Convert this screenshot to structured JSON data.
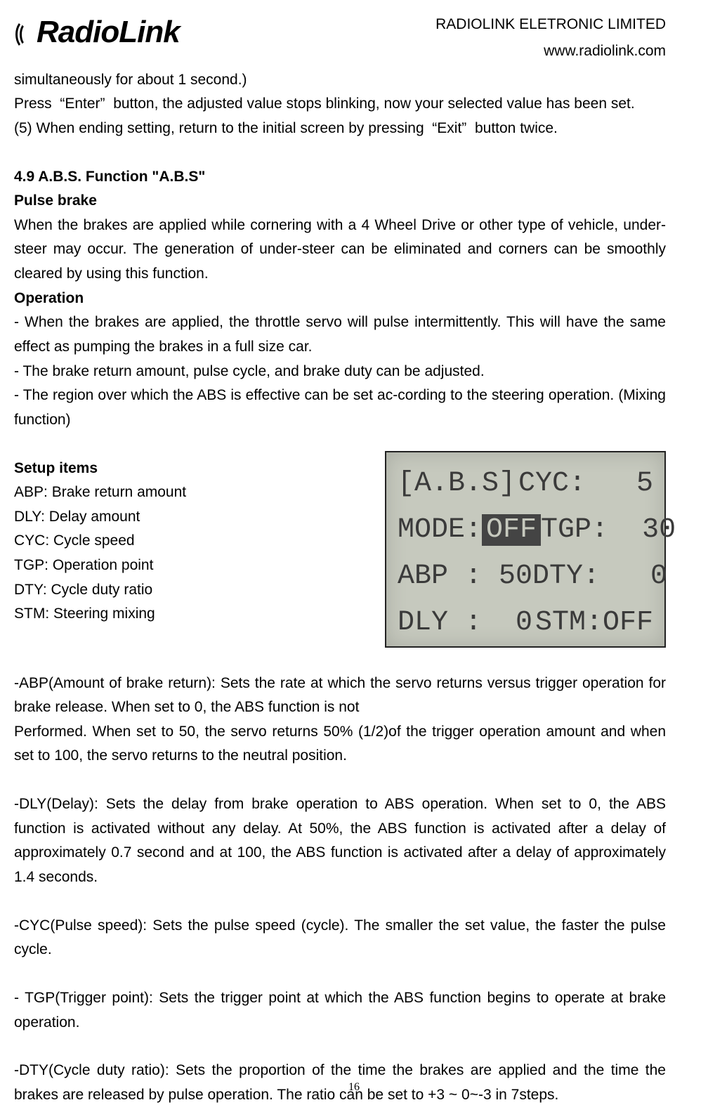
{
  "header": {
    "logo_text": "RadioLink",
    "company": "RADIOLINK ELETRONIC LIMITED",
    "url": "www.radiolink.com"
  },
  "body": {
    "p1": "simultaneously for about 1 second.)",
    "p2": "Press  “Enter”  button, the adjusted value stops blinking, now your selected value has been set.",
    "p3": "(5) When ending setting, return to the initial screen by pressing  “Exit”  button twice.",
    "h1": "4.9 A.B.S. Function \"A.B.S\"",
    "h2": "Pulse brake",
    "p4": "When the brakes are applied while cornering with a 4 Wheel Drive or other type of vehicle, under-steer may occur. The generation of under-steer can be eliminated and corners can be smoothly cleared by using this function.",
    "h3": "Operation",
    "p5": "- When the brakes are applied, the throttle servo will pulse intermittently. This will have the same effect as pumping the brakes in a full size car.",
    "p6": "- The brake return amount, pulse cycle, and brake duty can be adjusted.",
    "p7": "- The region over which the ABS is effective can be set ac-cording to the steering operation. (Mixing function)",
    "h4": "Setup items",
    "si1": "ABP: Brake return amount",
    "si2": "DLY: Delay amount",
    "si3": "CYC: Cycle speed",
    "si4": "TGP: Operation point",
    "si5": "DTY: Cycle duty ratio",
    "si6": "STM: Steering mixing",
    "p8": "-ABP(Amount of brake return): Sets the rate at which the servo returns versus trigger operation for brake release. When set to 0, the ABS function is not",
    "p9": "Performed. When set to 50, the servo returns 50% (1/2)of the trigger operation amount and when set to 100, the servo returns to the neutral position.",
    "p10": "-DLY(Delay): Sets the delay from brake operation to ABS operation. When set to 0, the ABS function is activated without any delay. At 50%, the ABS function is activated after a delay of approximately 0.7 second and at 100, the ABS function is activated after a delay of approximately 1.4 seconds.",
    "p11": "-CYC(Pulse speed): Sets the pulse speed (cycle). The smaller the set value, the faster the pulse cycle.",
    "p12": "- TGP(Trigger point): Sets the trigger point at which the ABS function begins to operate at brake operation.",
    "p13": "-DTY(Cycle duty ratio): Sets the proportion of the time the brakes are applied and the time the brakes are released by pulse operation. The ratio can be set to +3 ~ 0~-3 in 7steps."
  },
  "lcd": {
    "r1a": "[A.B.S]",
    "r1b": "CYC:   5",
    "r2a": "MODE:",
    "r2a_val": "OFF",
    "r2b": "TGP:  30",
    "r3a": "ABP : 50",
    "r3b": "DTY:   0",
    "r4a": "DLY :  0",
    "r4b": "STM:OFF"
  },
  "page_number": "16"
}
